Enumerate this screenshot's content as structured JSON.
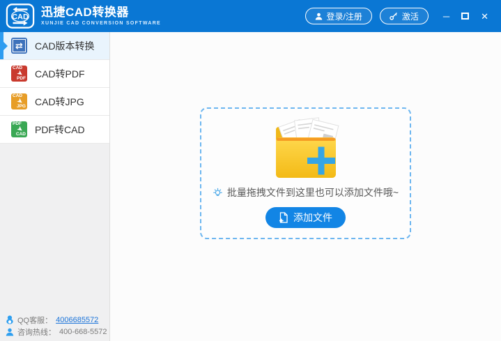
{
  "titlebar": {
    "logo_text": "CAD",
    "app_title": "迅捷CAD转换器",
    "app_subtitle": "XUNJIE CAD CONVERSION SOFTWARE",
    "login_button_label": "登录/注册",
    "activate_button_label": "激活",
    "minimize_glyph": "─",
    "close_glyph": "✕"
  },
  "sidebar": {
    "items": [
      {
        "label": "CAD版本转换",
        "selected": true,
        "icon_glyph": "⇄"
      },
      {
        "label": "CAD转PDF",
        "icon_from": "CAD",
        "icon_to": "PDF"
      },
      {
        "label": "CAD转JPG",
        "icon_from": "CAD",
        "icon_to": "JPG"
      },
      {
        "label": "PDF转CAD",
        "icon_from": "PDF",
        "icon_to": "CAD"
      }
    ],
    "icon_arrow_glyph": "➤",
    "support": {
      "qq_label": "QQ客服：",
      "qq_number": "4006685572",
      "hotline_label": "咨询热线：",
      "hotline_number": "400-668-5572"
    }
  },
  "main": {
    "dropzone_hint": "批量拖拽文件到这里也可以添加文件哦~",
    "add_files_button_label": "添加文件"
  },
  "colors": {
    "titlebar_blue": "#0a77d4",
    "accent_blue": "#1285e5",
    "selected_item_bg": "#e9f4fd",
    "selected_indicator": "#2e9cf0",
    "dropzone_border": "#6db6f0",
    "folder_yellow": "#f6c52f",
    "folder_stripe_orange": "#f59b23",
    "plus_blue": "#35a5e5",
    "link_blue": "#1a73d9",
    "icon_red": "#c93a2e",
    "icon_orange": "#e79d27",
    "icon_green": "#3aa854",
    "icon_blue": "#3e72bb"
  }
}
